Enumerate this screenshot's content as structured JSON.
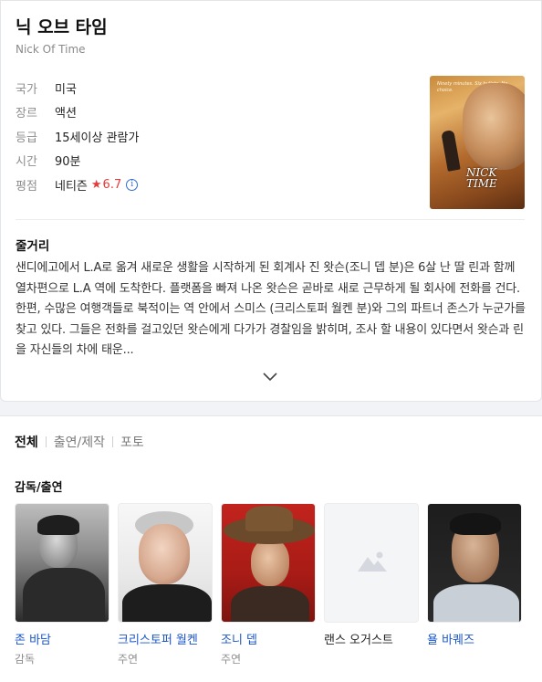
{
  "movie": {
    "title": "닉 오브 타임",
    "original_title": "Nick Of Time"
  },
  "info": {
    "country_label": "국가",
    "country": "미국",
    "genre_label": "장르",
    "genre": "액션",
    "rating_label": "등급",
    "rating_value": "15세이상 관람가",
    "runtime_label": "시간",
    "runtime": "90분",
    "score_label": "평점",
    "score_source": "네티즌",
    "score_star": "★",
    "score": "6.7",
    "info_icon": "i"
  },
  "poster": {
    "title_line1": "NICK",
    "title_line2": "TIME",
    "tag": "Ninety minutes. Six bullets. No choice."
  },
  "synopsis": {
    "heading": "줄거리",
    "text": "샌디에고에서 L.A로 옮겨 새로운 생활을 시작하게 된 회계사 진 왓슨(조니 뎁 분)은 6살 난 딸 린과 함께 열차편으로 L.A 역에 도착한다. 플랫폼을 빠져 나온 왓슨은 곧바로 새로 근무하게 될 회사에 전화를 건다. 한편, 수많은 여행객들로 북적이는 역 안에서 스미스 (크리스토퍼 월켄 분)와 그의 파트너 존스가 누군가를 찾고 있다. 그들은 전화를 걸고있던 왓슨에게 다가가 경찰임을 밝히며, 조사 할 내용이 있다면서 왓슨과 린을 자신들의 차에 태운..."
  },
  "tabs": [
    "전체",
    "출연/제작",
    "포토"
  ],
  "cast_heading": "감독/출연",
  "cast": [
    {
      "name": "존 바담",
      "role": "감독"
    },
    {
      "name": "크리스토퍼 월켄",
      "role": "주연"
    },
    {
      "name": "조니 뎁",
      "role": "주연"
    },
    {
      "name": "랜스 오거스트",
      "role": ""
    },
    {
      "name": "욜 바퀘즈",
      "role": ""
    }
  ],
  "colors": {
    "link": "#1a55c8",
    "star": "#e23b3b",
    "info_icon": "#2f6bd6"
  }
}
